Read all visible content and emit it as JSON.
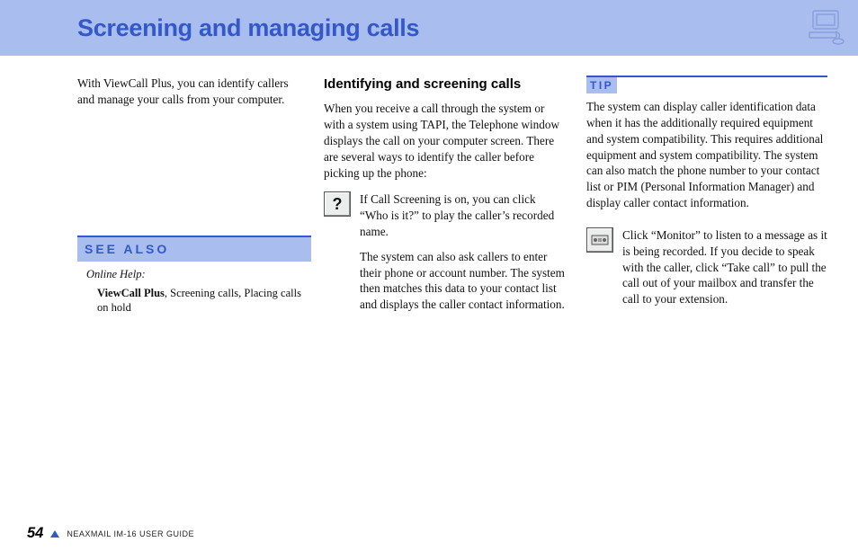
{
  "header": {
    "title": "Screening and managing calls"
  },
  "col1": {
    "intro": "With ViewCall Plus, you can identify callers and manage your calls from your computer."
  },
  "col2": {
    "heading": "Identifying and screening calls",
    "p1": "When you receive a call through the system or with a system using TAPI, the Telephone window displays the call on your computer screen. There are several ways to identify the caller before picking up the phone:",
    "iconText": "If Call Screening is on, you can click “Who is it?” to play the caller’s recorded name.",
    "p2": "The system can also ask callers to enter their phone or account number. The system then matches this data to your contact list and displays the caller contact information."
  },
  "col3": {
    "tipLabel": "TIP",
    "tipBody": "The system can display caller identification data when it has the additionally required equipment and system compatibility. This requires additional equipment and system compatibility. The system can also match the phone number to your contact list or PIM (Personal Information Manager) and display caller contact information.",
    "monitorText": "Click “Monitor” to listen to a message as it is being recorded. If you decide to speak with the caller, click “Take call” to pull the call out of your mailbox and transfer the call to your extension."
  },
  "seeAlso": {
    "head": "SEE ALSO",
    "onlineHelp": "Online Help:",
    "topicBold": "ViewCall Plus",
    "topicRest": ", Screening calls, Placing calls on hold"
  },
  "footer": {
    "page": "54",
    "guide": "NEAXMAIL IM-16 USER GUIDE"
  }
}
